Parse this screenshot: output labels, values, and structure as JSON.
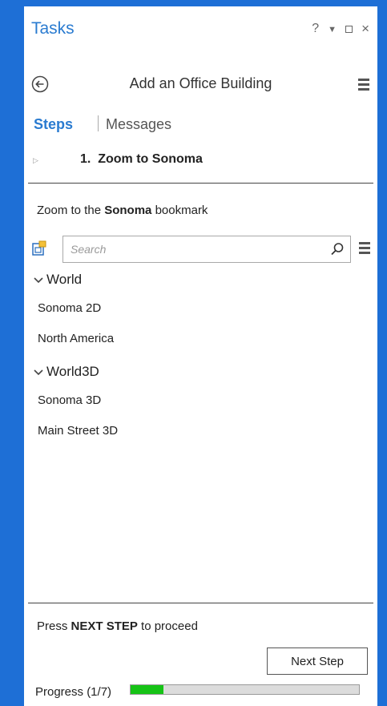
{
  "panel": {
    "title": "Tasks",
    "window_controls": {
      "help": "?",
      "close": "×"
    }
  },
  "header": {
    "title": "Add an Office Building"
  },
  "tabs": [
    {
      "label": "Steps",
      "active": true
    },
    {
      "label": "Messages",
      "active": false
    }
  ],
  "step": {
    "title": "1.  Zoom to Sonoma"
  },
  "instruction": {
    "prefix": "Zoom to the ",
    "bold": "Sonoma",
    "suffix": " bookmark"
  },
  "search": {
    "placeholder": "Search",
    "value": ""
  },
  "bookmarks": {
    "groups": [
      {
        "label": "World",
        "items": [
          "Sonoma 2D",
          "North America"
        ]
      },
      {
        "label": "World3D",
        "items": [
          "Sonoma 3D",
          "Main Street 3D"
        ]
      }
    ]
  },
  "footer": {
    "press_prefix": "Press ",
    "press_bold": "NEXT STEP",
    "press_suffix": " to proceed",
    "next_label": "Next Step",
    "progress_label": "Progress (1/7)",
    "progress_fraction": 0.143
  },
  "colors": {
    "frame": "#1e6fd6",
    "accent": "#2a7bd0",
    "progress": "#16c316"
  },
  "icons": [
    "help-icon",
    "dropdown-icon",
    "maximize-icon",
    "close-icon",
    "back-icon",
    "menu-icon",
    "bookmark-icon",
    "search-icon",
    "chevron-down-icon"
  ]
}
